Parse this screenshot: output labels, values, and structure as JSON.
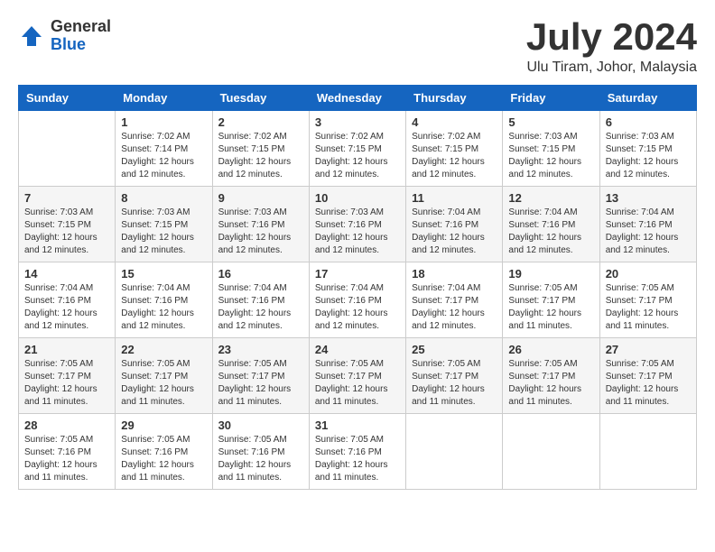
{
  "header": {
    "logo_general": "General",
    "logo_blue": "Blue",
    "month_title": "July 2024",
    "location": "Ulu Tiram, Johor, Malaysia"
  },
  "weekdays": [
    "Sunday",
    "Monday",
    "Tuesday",
    "Wednesday",
    "Thursday",
    "Friday",
    "Saturday"
  ],
  "weeks": [
    [
      {
        "day": "",
        "info": ""
      },
      {
        "day": "1",
        "info": "Sunrise: 7:02 AM\nSunset: 7:14 PM\nDaylight: 12 hours\nand 12 minutes."
      },
      {
        "day": "2",
        "info": "Sunrise: 7:02 AM\nSunset: 7:15 PM\nDaylight: 12 hours\nand 12 minutes."
      },
      {
        "day": "3",
        "info": "Sunrise: 7:02 AM\nSunset: 7:15 PM\nDaylight: 12 hours\nand 12 minutes."
      },
      {
        "day": "4",
        "info": "Sunrise: 7:02 AM\nSunset: 7:15 PM\nDaylight: 12 hours\nand 12 minutes."
      },
      {
        "day": "5",
        "info": "Sunrise: 7:03 AM\nSunset: 7:15 PM\nDaylight: 12 hours\nand 12 minutes."
      },
      {
        "day": "6",
        "info": "Sunrise: 7:03 AM\nSunset: 7:15 PM\nDaylight: 12 hours\nand 12 minutes."
      }
    ],
    [
      {
        "day": "7",
        "info": "Sunrise: 7:03 AM\nSunset: 7:15 PM\nDaylight: 12 hours\nand 12 minutes."
      },
      {
        "day": "8",
        "info": "Sunrise: 7:03 AM\nSunset: 7:15 PM\nDaylight: 12 hours\nand 12 minutes."
      },
      {
        "day": "9",
        "info": "Sunrise: 7:03 AM\nSunset: 7:16 PM\nDaylight: 12 hours\nand 12 minutes."
      },
      {
        "day": "10",
        "info": "Sunrise: 7:03 AM\nSunset: 7:16 PM\nDaylight: 12 hours\nand 12 minutes."
      },
      {
        "day": "11",
        "info": "Sunrise: 7:04 AM\nSunset: 7:16 PM\nDaylight: 12 hours\nand 12 minutes."
      },
      {
        "day": "12",
        "info": "Sunrise: 7:04 AM\nSunset: 7:16 PM\nDaylight: 12 hours\nand 12 minutes."
      },
      {
        "day": "13",
        "info": "Sunrise: 7:04 AM\nSunset: 7:16 PM\nDaylight: 12 hours\nand 12 minutes."
      }
    ],
    [
      {
        "day": "14",
        "info": "Sunrise: 7:04 AM\nSunset: 7:16 PM\nDaylight: 12 hours\nand 12 minutes."
      },
      {
        "day": "15",
        "info": "Sunrise: 7:04 AM\nSunset: 7:16 PM\nDaylight: 12 hours\nand 12 minutes."
      },
      {
        "day": "16",
        "info": "Sunrise: 7:04 AM\nSunset: 7:16 PM\nDaylight: 12 hours\nand 12 minutes."
      },
      {
        "day": "17",
        "info": "Sunrise: 7:04 AM\nSunset: 7:16 PM\nDaylight: 12 hours\nand 12 minutes."
      },
      {
        "day": "18",
        "info": "Sunrise: 7:04 AM\nSunset: 7:17 PM\nDaylight: 12 hours\nand 12 minutes."
      },
      {
        "day": "19",
        "info": "Sunrise: 7:05 AM\nSunset: 7:17 PM\nDaylight: 12 hours\nand 11 minutes."
      },
      {
        "day": "20",
        "info": "Sunrise: 7:05 AM\nSunset: 7:17 PM\nDaylight: 12 hours\nand 11 minutes."
      }
    ],
    [
      {
        "day": "21",
        "info": "Sunrise: 7:05 AM\nSunset: 7:17 PM\nDaylight: 12 hours\nand 11 minutes."
      },
      {
        "day": "22",
        "info": "Sunrise: 7:05 AM\nSunset: 7:17 PM\nDaylight: 12 hours\nand 11 minutes."
      },
      {
        "day": "23",
        "info": "Sunrise: 7:05 AM\nSunset: 7:17 PM\nDaylight: 12 hours\nand 11 minutes."
      },
      {
        "day": "24",
        "info": "Sunrise: 7:05 AM\nSunset: 7:17 PM\nDaylight: 12 hours\nand 11 minutes."
      },
      {
        "day": "25",
        "info": "Sunrise: 7:05 AM\nSunset: 7:17 PM\nDaylight: 12 hours\nand 11 minutes."
      },
      {
        "day": "26",
        "info": "Sunrise: 7:05 AM\nSunset: 7:17 PM\nDaylight: 12 hours\nand 11 minutes."
      },
      {
        "day": "27",
        "info": "Sunrise: 7:05 AM\nSunset: 7:17 PM\nDaylight: 12 hours\nand 11 minutes."
      }
    ],
    [
      {
        "day": "28",
        "info": "Sunrise: 7:05 AM\nSunset: 7:16 PM\nDaylight: 12 hours\nand 11 minutes."
      },
      {
        "day": "29",
        "info": "Sunrise: 7:05 AM\nSunset: 7:16 PM\nDaylight: 12 hours\nand 11 minutes."
      },
      {
        "day": "30",
        "info": "Sunrise: 7:05 AM\nSunset: 7:16 PM\nDaylight: 12 hours\nand 11 minutes."
      },
      {
        "day": "31",
        "info": "Sunrise: 7:05 AM\nSunset: 7:16 PM\nDaylight: 12 hours\nand 11 minutes."
      },
      {
        "day": "",
        "info": ""
      },
      {
        "day": "",
        "info": ""
      },
      {
        "day": "",
        "info": ""
      }
    ]
  ]
}
